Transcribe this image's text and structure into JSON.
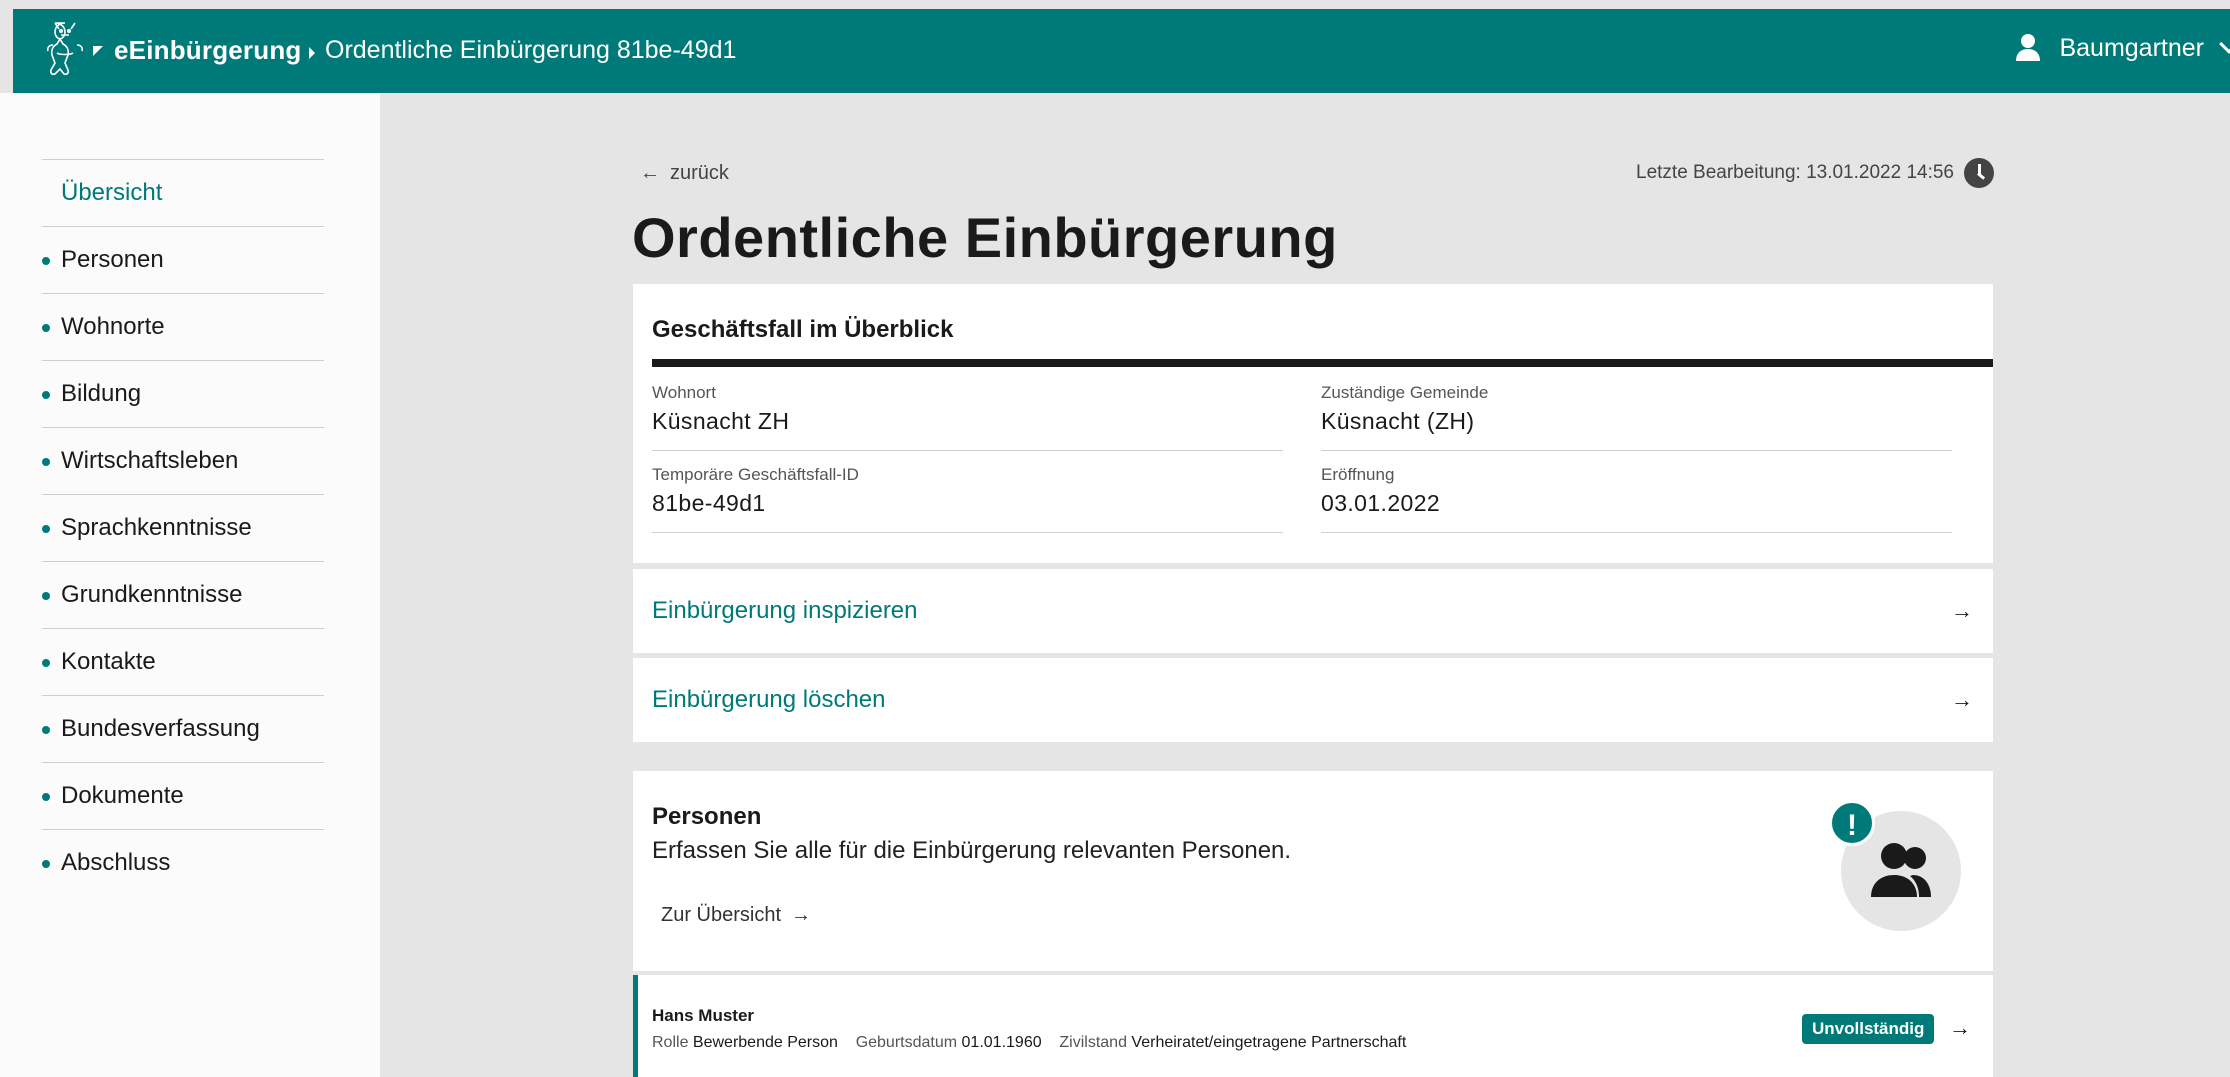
{
  "header": {
    "brand": "eEinbürgerung",
    "breadcrumb": "Ordentliche Einbürgerung 81be-49d1",
    "user": "Baumgartner"
  },
  "sidebar": {
    "items": [
      {
        "label": "Übersicht"
      },
      {
        "label": "Personen"
      },
      {
        "label": "Wohnorte"
      },
      {
        "label": "Bildung"
      },
      {
        "label": "Wirtschaftsleben"
      },
      {
        "label": "Sprachkenntnisse"
      },
      {
        "label": "Grundkenntnisse"
      },
      {
        "label": "Kontakte"
      },
      {
        "label": "Bundesverfassung"
      },
      {
        "label": "Dokumente"
      },
      {
        "label": "Abschluss"
      }
    ]
  },
  "main": {
    "back": "zurück",
    "last_edit": "Letzte Bearbeitung: 13.01.2022 14:56",
    "title": "Ordentliche Einbürgerung",
    "overview": {
      "heading": "Geschäftsfall im Überblick",
      "fields": [
        {
          "label": "Wohnort",
          "value": "Küsnacht ZH"
        },
        {
          "label": "Zuständige Gemeinde",
          "value": "Küsnacht (ZH)"
        },
        {
          "label": "Temporäre Geschäftsfall-ID",
          "value": "81be-49d1"
        },
        {
          "label": "Eröffnung",
          "value": "03.01.2022"
        }
      ]
    },
    "links": {
      "inspect": "Einbürgerung inspizieren",
      "delete": "Einbürgerung löschen"
    },
    "persons": {
      "heading": "Personen",
      "description": "Erfassen Sie alle für die Einbürgerung relevanten Personen.",
      "overview_link": "Zur Übersicht",
      "warning": "!",
      "rows": [
        {
          "name": "Hans Muster",
          "role_label": "Rolle",
          "role": "Bewerbende Person",
          "birth_label": "Geburtsdatum",
          "birth": "01.01.1960",
          "civil_label": "Zivilstand",
          "civil": "Verheiratet/eingetragene Partnerschaft",
          "status": "Unvollständig"
        }
      ]
    }
  },
  "colors": {
    "accent": "#007a78",
    "background": "#e5e5e5"
  },
  "icons": {
    "logo": "lion-coat-of-arms-icon",
    "user": "user-icon",
    "clock": "clock-icon",
    "people": "people-group-icon"
  }
}
